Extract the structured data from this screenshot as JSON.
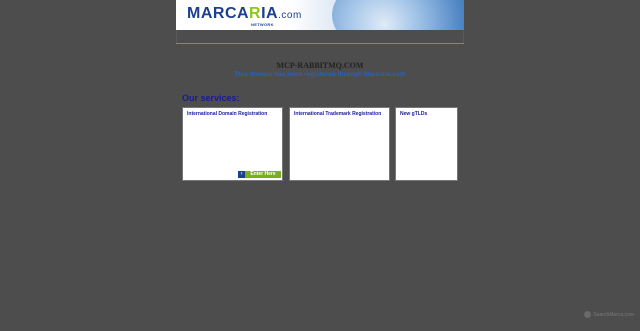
{
  "banner": {
    "logo_main_1": "MARCA",
    "logo_q": "R",
    "logo_main_2": "IA",
    "logo_tld": ".com",
    "logo_network": "NETWORK"
  },
  "main": {
    "domain_title": "MCP-RABBITMQ.COM",
    "registered_line": "This domain has been registered through Marcaria.com"
  },
  "services": {
    "heading": "Our services:",
    "cards": [
      {
        "title": "International Domain Registration",
        "button_label": "Enter Here"
      },
      {
        "title": "International Trademark Registration"
      },
      {
        "title": "New gTLDs"
      }
    ]
  },
  "watermark": {
    "text": "SearchMarca.com"
  },
  "colors": {
    "background": "#4d4d4d",
    "heading_blue": "#1a1a9a",
    "link_blue": "#2b5fbf",
    "accent_green": "#7bb01a"
  }
}
